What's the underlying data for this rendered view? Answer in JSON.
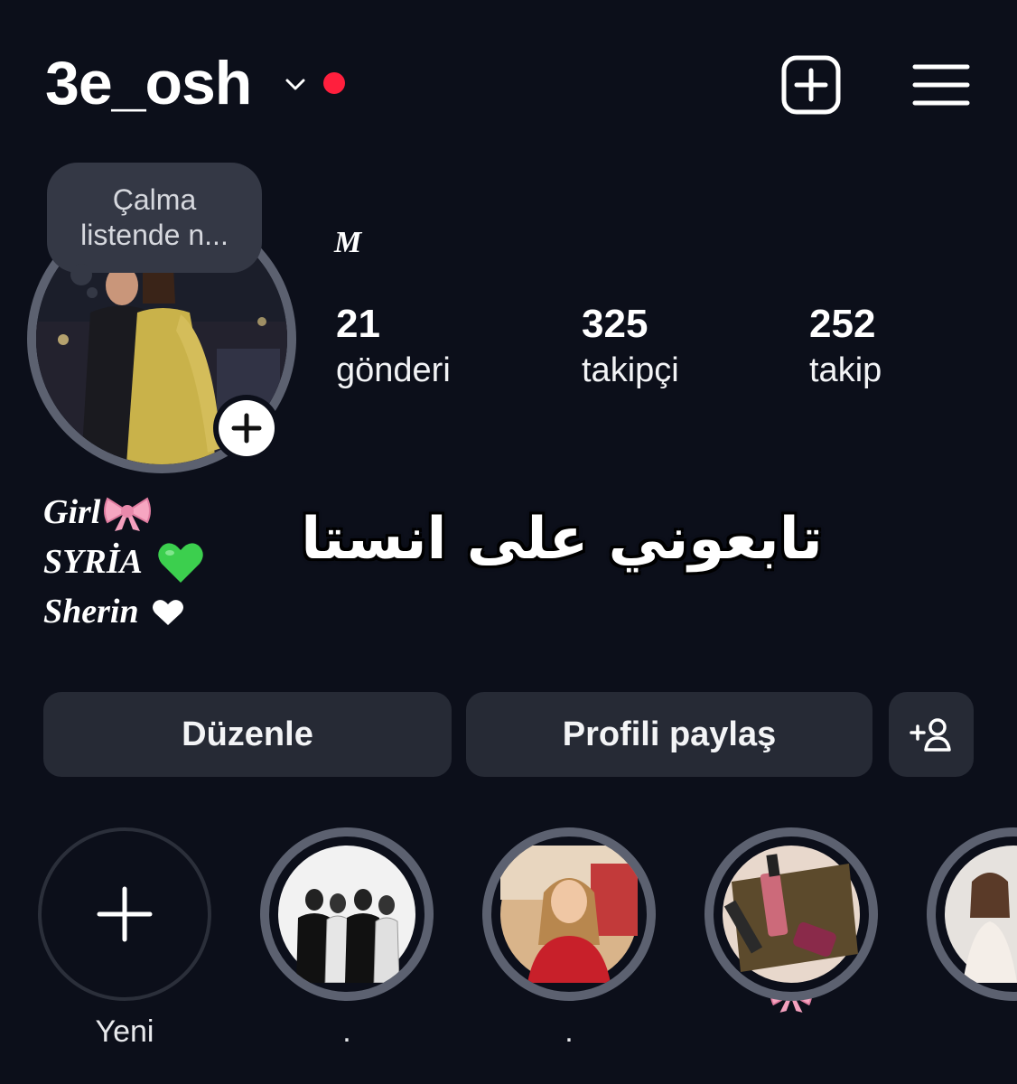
{
  "header": {
    "username": "3e_osh",
    "create_icon": "plus-square-icon",
    "menu_icon": "hamburger-menu-icon",
    "notification_dot_color": "#ff1f3d"
  },
  "note": {
    "line1": "Çalma",
    "line2": "listende n..."
  },
  "profile": {
    "display_name": "M",
    "stats": [
      {
        "value": "21",
        "label": "gönderi"
      },
      {
        "value": "325",
        "label": "takipçi"
      },
      {
        "value": "252",
        "label": "takip"
      }
    ],
    "bio": [
      {
        "text": "Girl",
        "icon": "ribbon-bow-icon"
      },
      {
        "text": "SYRİA",
        "icon": "green-heart-icon"
      },
      {
        "text": "Sherin",
        "icon": "white-heart-icon"
      }
    ]
  },
  "overlay_text": "تابعوني على انستا",
  "actions": {
    "edit_label": "Düzenle",
    "share_label": "Profili paylaş",
    "discover_icon": "add-person-icon"
  },
  "highlights": [
    {
      "label": "Yeni",
      "type": "new"
    },
    {
      "label": ".",
      "type": "story"
    },
    {
      "label": ".",
      "type": "story"
    },
    {
      "label": "",
      "type": "story",
      "label_icon": "ribbon-bow-icon"
    },
    {
      "label": "",
      "type": "story"
    }
  ],
  "colors": {
    "background": "#0c0f1a",
    "button": "#262a35",
    "ring": "#5c6170",
    "note_bubble": "#343845"
  }
}
